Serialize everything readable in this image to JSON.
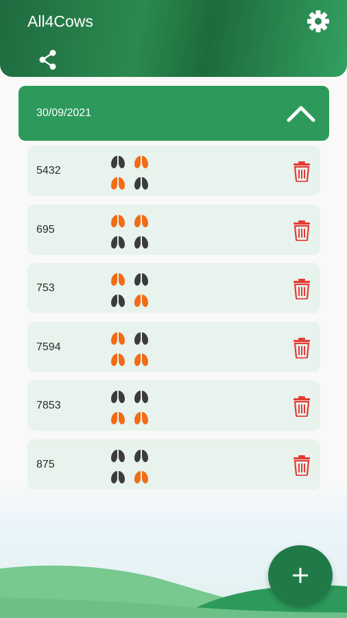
{
  "app": {
    "title": "All4Cows"
  },
  "colors": {
    "primary": "#2d9a5c",
    "card": "#e7f3ec",
    "teat_dark": "#3c3c3c",
    "teat_orange": "#f26b16",
    "delete_red": "#e53935"
  },
  "icons": {
    "settings": "gear-icon",
    "share": "share-icon",
    "collapse": "chevron-up-icon",
    "delete": "trash-icon",
    "add": "plus-icon",
    "teat": "teat-icon"
  },
  "group": {
    "date": "30/09/2021",
    "expanded": true
  },
  "records": [
    {
      "id": "5432",
      "teats": [
        "dark",
        "orange",
        "orange",
        "dark"
      ]
    },
    {
      "id": "695",
      "teats": [
        "orange",
        "orange",
        "dark",
        "dark"
      ]
    },
    {
      "id": "753",
      "teats": [
        "orange",
        "dark",
        "dark",
        "orange"
      ]
    },
    {
      "id": "7594",
      "teats": [
        "orange",
        "dark",
        "orange",
        "orange"
      ]
    },
    {
      "id": "7853",
      "teats": [
        "dark",
        "dark",
        "orange",
        "orange"
      ]
    },
    {
      "id": "875",
      "teats": [
        "dark",
        "dark",
        "dark",
        "orange"
      ]
    }
  ]
}
